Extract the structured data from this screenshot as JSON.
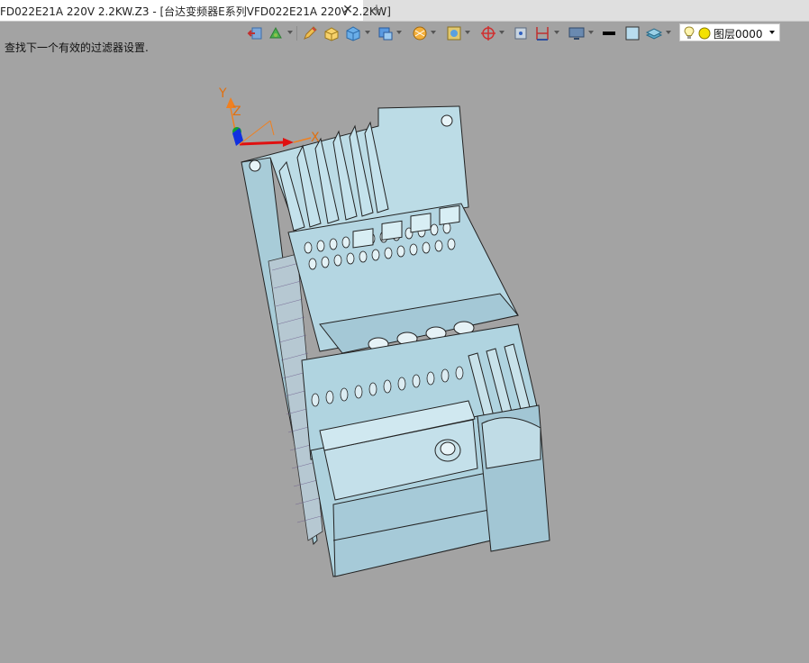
{
  "tab": {
    "title": "FD022E21A 220V 2.2KW.Z3 - [台达变频器E系列VFD022E21A 220V 2.2KW]",
    "close_glyph": "✕",
    "add_glyph": "+"
  },
  "toolbar": {
    "icons": [
      "exit-sketch-icon",
      "fill-tool-icon",
      "edit-pencil-icon",
      "solid-box-icon",
      "cube-icon",
      "view-orientation-icon",
      "render-mode-icon",
      "display-filter-icon",
      "axis-origin-icon",
      "point-select-icon",
      "dimension-icon",
      "monitor-icon",
      "line-color-icon",
      "fill-color-icon",
      "layer-stack-icon"
    ]
  },
  "layer": {
    "value": "图层0000",
    "status_color": "#f4e200"
  },
  "status": {
    "hint": "查找下一个有效的过滤器设置."
  },
  "viewport": {
    "axis": {
      "x_label": "X",
      "y_label": "Y",
      "z_label": "Z"
    },
    "model_color": "#b8d8e2"
  }
}
